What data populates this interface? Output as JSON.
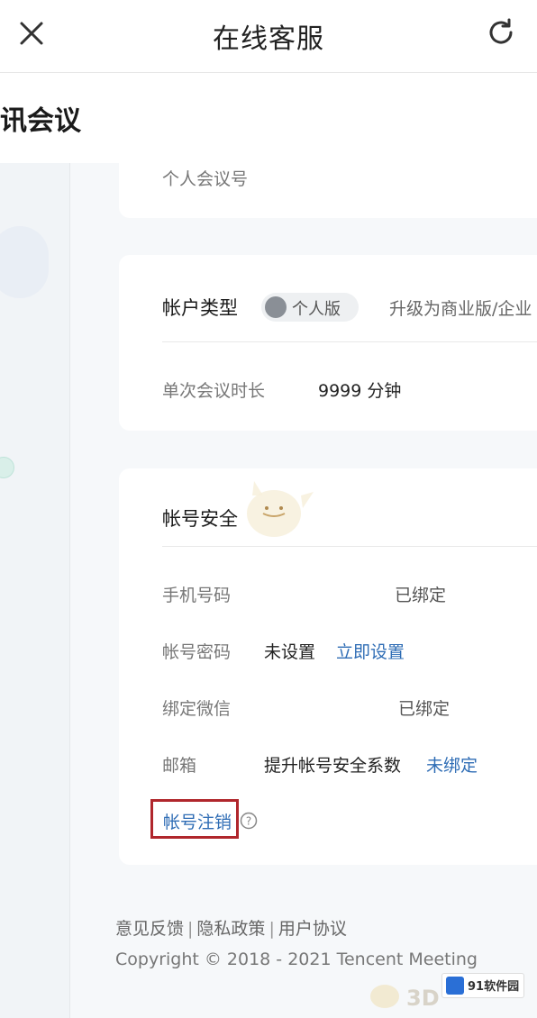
{
  "topbar": {
    "title": "在线客服"
  },
  "app": {
    "name": "讯会议"
  },
  "card1": {
    "label": "个人会议号"
  },
  "card2": {
    "account_type_label": "帐户类型",
    "badge": "个人版",
    "upgrade_link": "升级为商业版/企业",
    "duration_label": "单次会议时长",
    "duration_value": "9999 分钟"
  },
  "security": {
    "heading": "帐号安全",
    "rows": [
      {
        "label": "手机号码",
        "value": "已绑定"
      },
      {
        "label": "帐号密码",
        "value": "未设置",
        "action": "立即设置"
      },
      {
        "label": "绑定微信",
        "value": "已绑定"
      },
      {
        "label": "邮箱",
        "value": "提升帐号安全系数",
        "action": "未绑定"
      }
    ],
    "delete_link": "帐号注销"
  },
  "footer": {
    "feedback": "意见反馈",
    "privacy": "隐私政策",
    "agreement": "用户协议",
    "copyright": "Copyright © 2018 - 2021 Tencent Meeting"
  },
  "watermark": {
    "text": "91软件园"
  },
  "colors": {
    "link": "#2f6db5",
    "highlight_box": "#b0262c"
  }
}
